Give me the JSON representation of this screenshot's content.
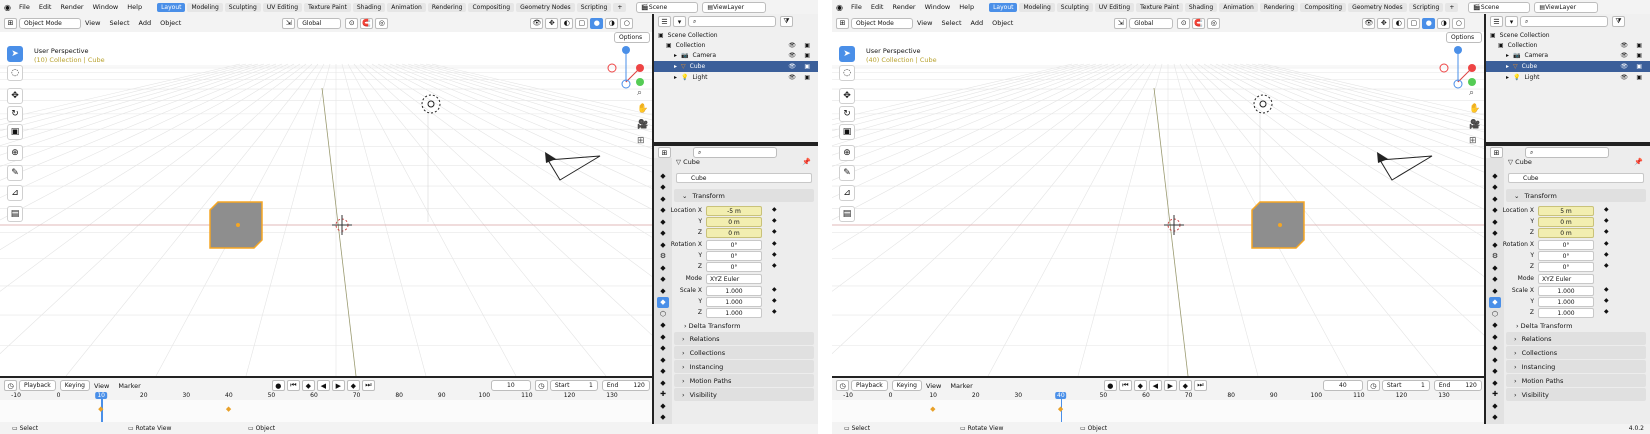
{
  "panes": [
    {
      "menu": [
        "File",
        "Edit",
        "Render",
        "Window",
        "Help"
      ],
      "workspaces": [
        "Layout",
        "Modeling",
        "Sculpting",
        "UV Editing",
        "Texture Paint",
        "Shading",
        "Animation",
        "Rendering",
        "Compositing",
        "Geometry Nodes",
        "Scripting",
        "+"
      ],
      "active_workspace": "Layout",
      "scene": "Scene",
      "view_layer": "ViewLayer",
      "mode": "Object Mode",
      "view_menu": [
        "View",
        "Select",
        "Add",
        "Object"
      ],
      "orientation": "Global",
      "options": "Options",
      "viewport_title": "User Perspective",
      "viewport_subtitle": "(10) Collection | Cube",
      "outliner": {
        "scene_collection": "Scene Collection",
        "collection": "Collection",
        "items": [
          "Camera",
          "Cube",
          "Light"
        ]
      },
      "props": {
        "object_name": "Cube",
        "object_field": "Cube",
        "transform": "Transform",
        "location_label": "Location X",
        "loc": [
          "-5 m",
          "0 m",
          "0 m"
        ],
        "rotation_label": "Rotation X",
        "rot": [
          "0°",
          "0°",
          "0°"
        ],
        "mode_label": "Mode",
        "mode_value": "XYZ Euler",
        "scale_label": "Scale X",
        "scale": [
          "1.000",
          "1.000",
          "1.000"
        ],
        "y": "Y",
        "z": "Z",
        "delta": "Delta Transform",
        "panels": [
          "Relations",
          "Collections",
          "Instancing",
          "Motion Paths",
          "Visibility"
        ]
      },
      "timeline": {
        "menu": [
          "Playback",
          "Keying",
          "View",
          "Marker"
        ],
        "current_frame": "10",
        "start_label": "Start",
        "start": "1",
        "end_label": "End",
        "end": "120",
        "ticks": [
          "-10",
          "0",
          "10",
          "20",
          "30",
          "40",
          "50",
          "60",
          "70",
          "80",
          "90",
          "100",
          "110",
          "120",
          "130"
        ],
        "playhead": "10"
      },
      "status": [
        "Select",
        "Rotate View",
        "Object"
      ],
      "version": ""
    },
    {
      "menu": [
        "File",
        "Edit",
        "Render",
        "Window",
        "Help"
      ],
      "workspaces": [
        "Layout",
        "Modeling",
        "Sculpting",
        "UV Editing",
        "Texture Paint",
        "Shading",
        "Animation",
        "Rendering",
        "Compositing",
        "Geometry Nodes",
        "Scripting",
        "+"
      ],
      "active_workspace": "Layout",
      "scene": "Scene",
      "view_layer": "ViewLayer",
      "mode": "Object Mode",
      "view_menu": [
        "View",
        "Select",
        "Add",
        "Object"
      ],
      "orientation": "Global",
      "options": "Options",
      "viewport_title": "User Perspective",
      "viewport_subtitle": "(40) Collection | Cube",
      "outliner": {
        "scene_collection": "Scene Collection",
        "collection": "Collection",
        "items": [
          "Camera",
          "Cube",
          "Light"
        ]
      },
      "props": {
        "object_name": "Cube",
        "object_field": "Cube",
        "transform": "Transform",
        "location_label": "Location X",
        "loc": [
          "5 m",
          "0 m",
          "0 m"
        ],
        "rotation_label": "Rotation X",
        "rot": [
          "0°",
          "0°",
          "0°"
        ],
        "mode_label": "Mode",
        "mode_value": "XYZ Euler",
        "scale_label": "Scale X",
        "scale": [
          "1.000",
          "1.000",
          "1.000"
        ],
        "y": "Y",
        "z": "Z",
        "delta": "Delta Transform",
        "panels": [
          "Relations",
          "Collections",
          "Instancing",
          "Motion Paths",
          "Visibility"
        ]
      },
      "timeline": {
        "menu": [
          "Playback",
          "Keying",
          "View",
          "Marker"
        ],
        "current_frame": "40",
        "start_label": "Start",
        "start": "1",
        "end_label": "End",
        "end": "120",
        "ticks": [
          "-10",
          "0",
          "10",
          "20",
          "30",
          "40",
          "50",
          "60",
          "70",
          "80",
          "90",
          "100",
          "110",
          "120",
          "130"
        ],
        "playhead": "40"
      },
      "status": [
        "Select",
        "Rotate View",
        "Object"
      ],
      "version": "4.0.2"
    }
  ],
  "colors": {
    "accent": "#4a8fe8",
    "select_outline": "#f5a623",
    "keyframe_field": "#f2eeb0"
  }
}
